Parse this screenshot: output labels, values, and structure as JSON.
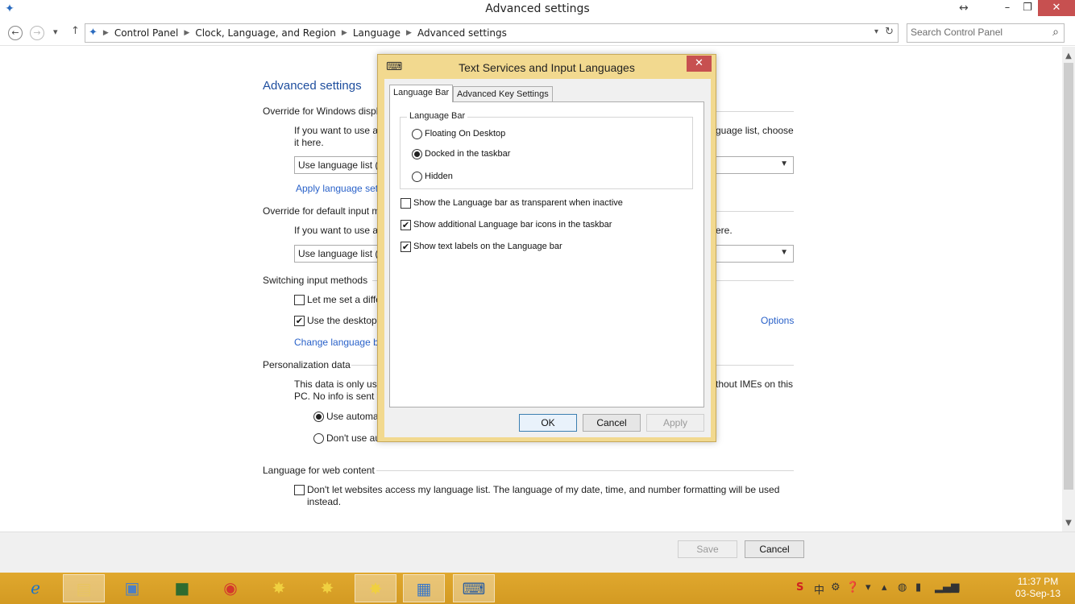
{
  "window": {
    "title": "Advanced settings",
    "app_icon": "language-globe-icon",
    "controls": {
      "resize": "↔",
      "minimize": "–",
      "maximize": "❐",
      "close": "✕"
    }
  },
  "address": {
    "back": "←",
    "forward": "→",
    "recent": "▾",
    "up": "↑",
    "breadcrumbs": [
      "Control Panel",
      "Clock, Language, and Region",
      "Language",
      "Advanced settings"
    ],
    "dropdown": "▾",
    "refresh": "↻"
  },
  "search": {
    "placeholder": "Search Control Panel",
    "icon": "⌕"
  },
  "page": {
    "heading": "Advanced settings",
    "sec1_title": "Override for Windows displ",
    "sec1_text_left": "If you want to use a",
    "sec1_text_right": "guage list, choose",
    "sec1_text_line2": "it here.",
    "sec1_select": "Use language list (r",
    "sec1_link": "Apply language sett",
    "sec2_title": "Override for default input m",
    "sec2_text_left": "If you want to use a",
    "sec2_text_right": "ere.",
    "sec2_select": "Use language list (r",
    "sec3_title": "Switching input methods",
    "sec3_cb1": "Let me set a diffe",
    "sec3_cb2": "Use the desktop l",
    "sec3_options": "Options",
    "sec3_link": "Change language ba",
    "sec4_title": "Personalization data",
    "sec4_text_left": "This data is only use",
    "sec4_text_right": "thout IMEs on this",
    "sec4_text_line2": "PC. No info is sent t",
    "sec4_rb1": "Use automa",
    "sec4_rb2": "Don't use au",
    "sec5_title": "Language for web content",
    "sec5_cb_line1": "Don't let websites access my language list. The language of my date, time, and number formatting will be used",
    "sec5_cb_line2": "instead."
  },
  "footer": {
    "save": "Save",
    "cancel": "Cancel"
  },
  "dialog": {
    "title": "Text Services and Input Languages",
    "close": "✕",
    "tabs": [
      "Language Bar",
      "Advanced Key Settings"
    ],
    "group_label": "Language Bar",
    "radios": [
      "Floating On Desktop",
      "Docked in the taskbar",
      "Hidden"
    ],
    "selected_radio": 1,
    "checkboxes": [
      {
        "label": "Show the Language bar as transparent when inactive",
        "checked": false
      },
      {
        "label": "Show additional Language bar icons in the taskbar",
        "checked": true
      },
      {
        "label": "Show text labels on the Language bar",
        "checked": true
      }
    ],
    "ok": "OK",
    "cancel": "Cancel",
    "apply": "Apply"
  },
  "taskbar": {
    "apps": [
      "internet-explorer-icon",
      "file-explorer-icon",
      "contacts-app-icon",
      "evernote-icon",
      "chrome-icon",
      "puzzle-app-icon",
      "puzzle-app-2-icon",
      "puzzle-app-3-icon",
      "remote-desktop-icon",
      "language-bar-keyboard-icon"
    ],
    "clock_time": "11:37 PM",
    "clock_date": "03-Sep-13"
  }
}
